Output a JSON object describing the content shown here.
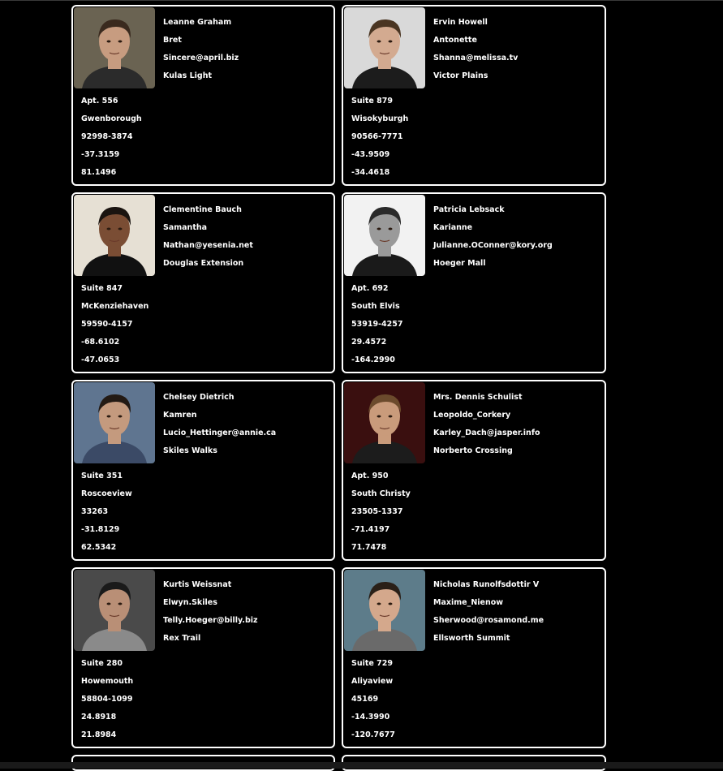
{
  "users": [
    {
      "name": "Leanne Graham",
      "username": "Bret",
      "email": "Sincere@april.biz",
      "street": "Kulas Light",
      "suite": "Apt. 556",
      "city": "Gwenborough",
      "zipcode": "92998-3874",
      "lat": "-37.3159",
      "lng": "81.1496",
      "photo": {
        "bg": "#6a6352",
        "skin": "#c79c80",
        "hair": "#3a2a1e",
        "shirt": "#2b2b2b"
      }
    },
    {
      "name": "Ervin Howell",
      "username": "Antonette",
      "email": "Shanna@melissa.tv",
      "street": "Victor Plains",
      "suite": "Suite 879",
      "city": "Wisokyburgh",
      "zipcode": "90566-7771",
      "lat": "-43.9509",
      "lng": "-34.4618",
      "photo": {
        "bg": "#d9d9d9",
        "skin": "#d3aa90",
        "hair": "#4a3522",
        "shirt": "#1c1c1c"
      }
    },
    {
      "name": "Clementine Bauch",
      "username": "Samantha",
      "email": "Nathan@yesenia.net",
      "street": "Douglas Extension",
      "suite": "Suite 847",
      "city": "McKenziehaven",
      "zipcode": "59590-4157",
      "lat": "-68.6102",
      "lng": "-47.0653",
      "photo": {
        "bg": "#e6e0d4",
        "skin": "#7a4d34",
        "hair": "#1a1410",
        "shirt": "#111111"
      }
    },
    {
      "name": "Patricia Lebsack",
      "username": "Karianne",
      "email": "Julianne.OConner@kory.org",
      "street": "Hoeger Mall",
      "suite": "Apt. 692",
      "city": "South Elvis",
      "zipcode": "53919-4257",
      "lat": "29.4572",
      "lng": "-164.2990",
      "photo": {
        "bg": "#f2f2f2",
        "skin": "#9a9a9a",
        "hair": "#2a2a2a",
        "shirt": "#1a1a1a"
      }
    },
    {
      "name": "Chelsey Dietrich",
      "username": "Kamren",
      "email": "Lucio_Hettinger@annie.ca",
      "street": "Skiles Walks",
      "suite": "Suite 351",
      "city": "Roscoeview",
      "zipcode": "33263",
      "lat": "-31.8129",
      "lng": "62.5342",
      "photo": {
        "bg": "#5f7590",
        "skin": "#c49a7e",
        "hair": "#231a14",
        "shirt": "#3b4a66"
      }
    },
    {
      "name": "Mrs. Dennis Schulist",
      "username": "Leopoldo_Corkery",
      "email": "Karley_Dach@jasper.info",
      "street": "Norberto Crossing",
      "suite": "Apt. 950",
      "city": "South Christy",
      "zipcode": "23505-1337",
      "lat": "-71.4197",
      "lng": "71.7478",
      "photo": {
        "bg": "#3a0f0f",
        "skin": "#c99b7b",
        "hair": "#6b4a2c",
        "shirt": "#1c1c1c"
      }
    },
    {
      "name": "Kurtis Weissnat",
      "username": "Elwyn.Skiles",
      "email": "Telly.Hoeger@billy.biz",
      "street": "Rex Trail",
      "suite": "Suite 280",
      "city": "Howemouth",
      "zipcode": "58804-1099",
      "lat": "24.8918",
      "lng": "21.8984",
      "photo": {
        "bg": "#4a4a4a",
        "skin": "#b98f76",
        "hair": "#1a1a1a",
        "shirt": "#8a8a8a"
      }
    },
    {
      "name": "Nicholas Runolfsdottir V",
      "username": "Maxime_Nienow",
      "email": "Sherwood@rosamond.me",
      "street": "Ellsworth Summit",
      "suite": "Suite 729",
      "city": "Aliyaview",
      "zipcode": "45169",
      "lat": "-14.3990",
      "lng": "-120.7677",
      "photo": {
        "bg": "#5d7c8a",
        "skin": "#d4a88c",
        "hair": "#2a2018",
        "shirt": "#6a6a6a"
      }
    }
  ]
}
